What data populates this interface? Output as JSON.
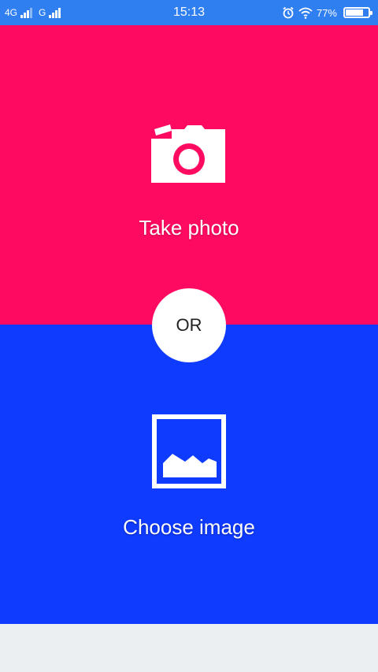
{
  "status_bar": {
    "network_1": "4G",
    "network_2": "G",
    "time": "15:13",
    "battery_text": "77%",
    "battery_level": 0.77,
    "icons": [
      "alarm-icon",
      "wifi-icon",
      "battery-icon"
    ]
  },
  "take_photo": {
    "label": "Take photo",
    "icon": "camera-icon",
    "color": "#ff0a61"
  },
  "divider": {
    "label": "OR"
  },
  "choose_image": {
    "label": "Choose image",
    "icon": "image-icon",
    "color": "#0f3bff"
  },
  "colors": {
    "status_bar": "#2f7ff0",
    "footer": "#eceff1"
  }
}
